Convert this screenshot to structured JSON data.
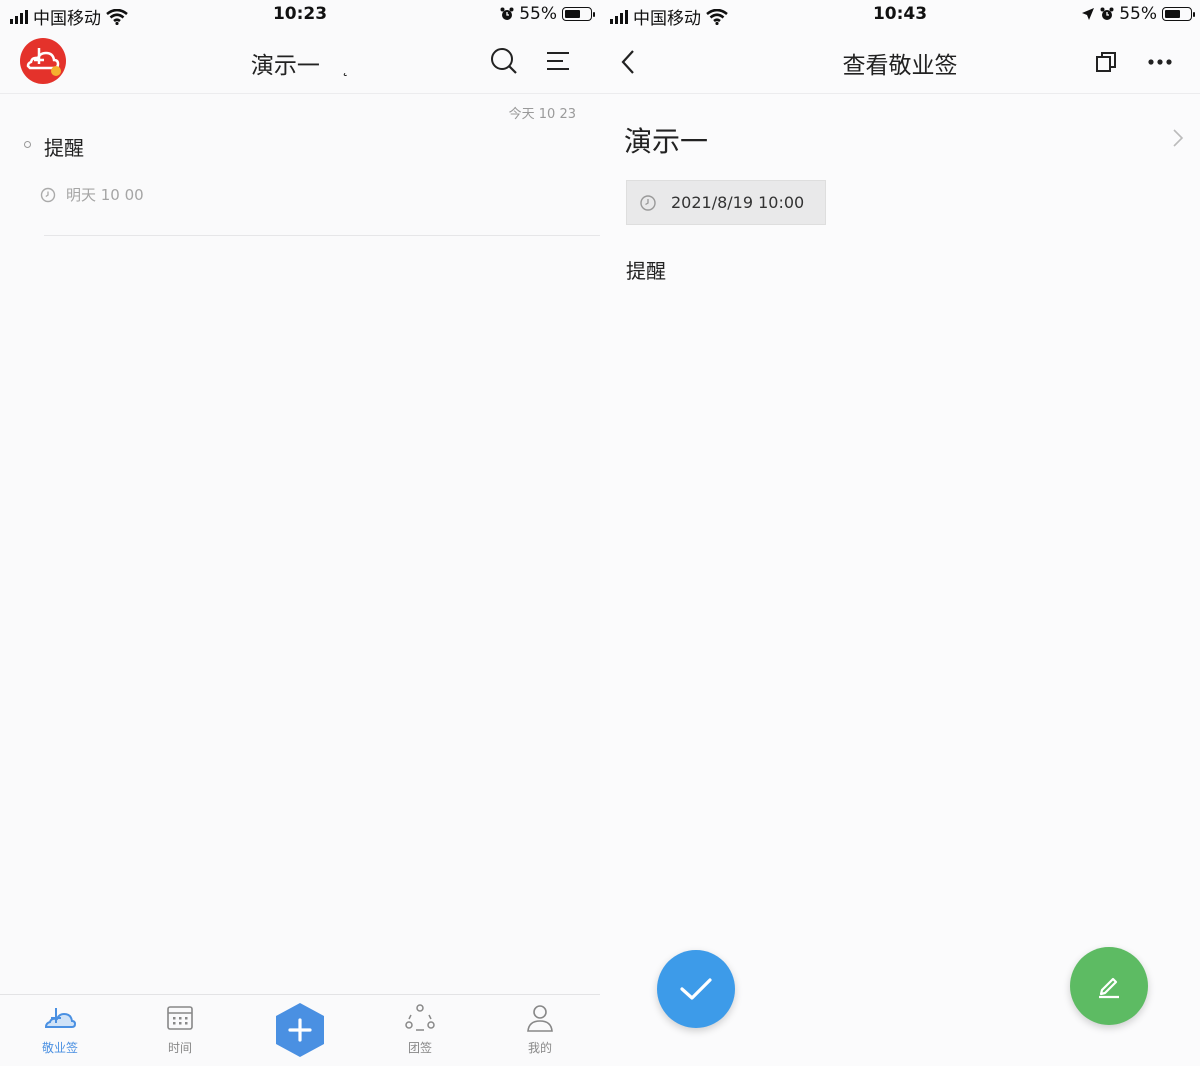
{
  "left": {
    "status": {
      "carrier": "中国移动",
      "time": "10:23",
      "battery": "55%",
      "battery_level": 0.55
    },
    "header": {
      "title": "演示一",
      "title_suffix": "˛"
    },
    "list": {
      "timestamp": "今天 10 23",
      "items": [
        {
          "title": "提醒",
          "reminder": "明天 10 00"
        }
      ]
    },
    "tabs": [
      {
        "label": "敬业签",
        "icon": "notes-cloud-icon",
        "active": true
      },
      {
        "label": "时间",
        "icon": "calendar-icon",
        "active": false
      },
      {
        "label": "",
        "icon": "add-hexagon-icon",
        "active": false
      },
      {
        "label": "团签",
        "icon": "team-icon",
        "active": false
      },
      {
        "label": "我的",
        "icon": "person-icon",
        "active": false
      }
    ]
  },
  "right": {
    "status": {
      "carrier": "中国移动",
      "time": "10:43",
      "battery": "55%",
      "battery_level": 0.55
    },
    "header": {
      "title": "查看敬业签"
    },
    "note": {
      "title": "演示一",
      "date": "2021/8/19 10:00",
      "body": "提醒"
    }
  },
  "colors": {
    "brand_red": "#e4322b",
    "accent_blue": "#4a90e2",
    "done_blue": "#3d9be9",
    "edit_green": "#5dbb63"
  }
}
